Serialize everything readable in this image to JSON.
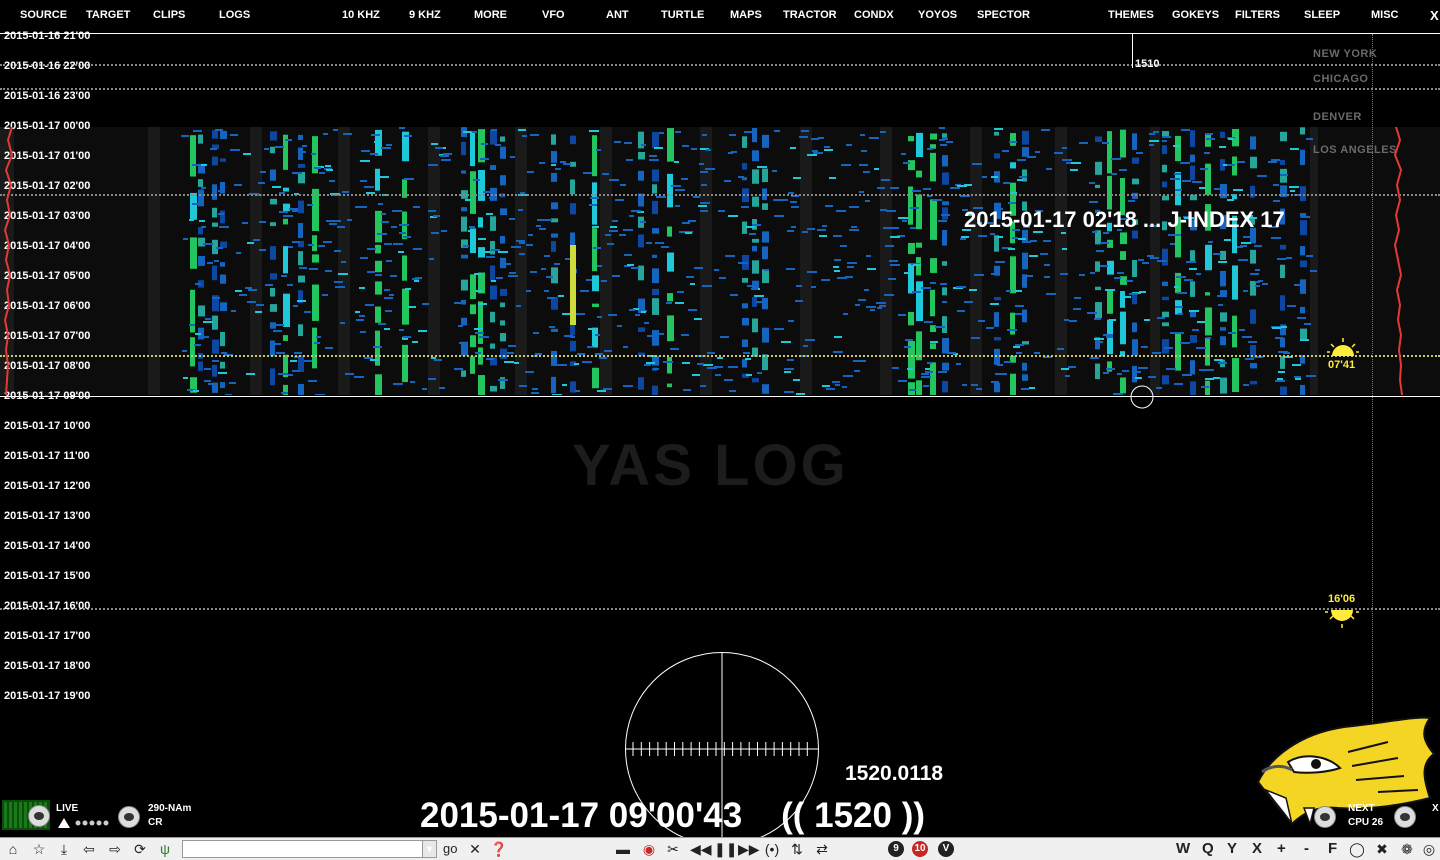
{
  "menu": {
    "left": [
      "SOURCE",
      "TARGET",
      "CLIPS",
      "LOGS"
    ],
    "middle": [
      "10 KHZ",
      "9 KHZ",
      "MORE",
      "VFO",
      "ANT",
      "TURTLE",
      "MAPS",
      "TRACTOR",
      "CONDX",
      "YOYOS",
      "SPECTOR"
    ],
    "right": [
      "THEMES",
      "GOKEYS",
      "FILTERS",
      "SLEEP",
      "MISC"
    ],
    "close": "X"
  },
  "timeline": [
    "2015-01-16 21'00",
    "2015-01-16 22'00",
    "2015-01-16 23'00",
    "2015-01-17 00'00",
    "2015-01-17 01'00",
    "2015-01-17 02'00",
    "2015-01-17 03'00",
    "2015-01-17 04'00",
    "2015-01-17 05'00",
    "2015-01-17 06'00",
    "2015-01-17 07'00",
    "2015-01-17 08'00",
    "2015-01-17 09'00",
    "2015-01-17 10'00",
    "2015-01-17 11'00",
    "2015-01-17 12'00",
    "2015-01-17 13'00",
    "2015-01-17 14'00",
    "2015-01-17 15'00",
    "2015-01-17 16'00",
    "2015-01-17 17'00",
    "2015-01-17 18'00",
    "2015-01-17 19'00"
  ],
  "cities": [
    "NEW YORK",
    "CHICAGO",
    "DENVER",
    "LOS ANGELES"
  ],
  "marker": "1510",
  "jindex": "2015-01-17 02'18 ... J-INDEX 17",
  "watermark": "YAS LOG",
  "sunrise": "07'41",
  "sunset": "16'06",
  "frequency": "1520.0118",
  "clock": "2015-01-17 09'00'43    (( 1520 ))",
  "status": {
    "live": "LIVE",
    "station": "290-NAm",
    "mode": "CR",
    "next": "NEXT",
    "cpu": "CPU 26",
    "x": "X"
  },
  "toolbar": {
    "go": "go",
    "letters": [
      "W",
      "Q",
      "Y",
      "X",
      "+",
      "-",
      "F"
    ],
    "badge9": "9",
    "badge10": "10",
    "badgeV": "V"
  },
  "colors": {
    "wf_green": "#22c55e",
    "wf_cyan": "#1ec8d8",
    "wf_blue": "#1565c0",
    "sun": "#ffeb3b",
    "trace": "#e53935"
  }
}
